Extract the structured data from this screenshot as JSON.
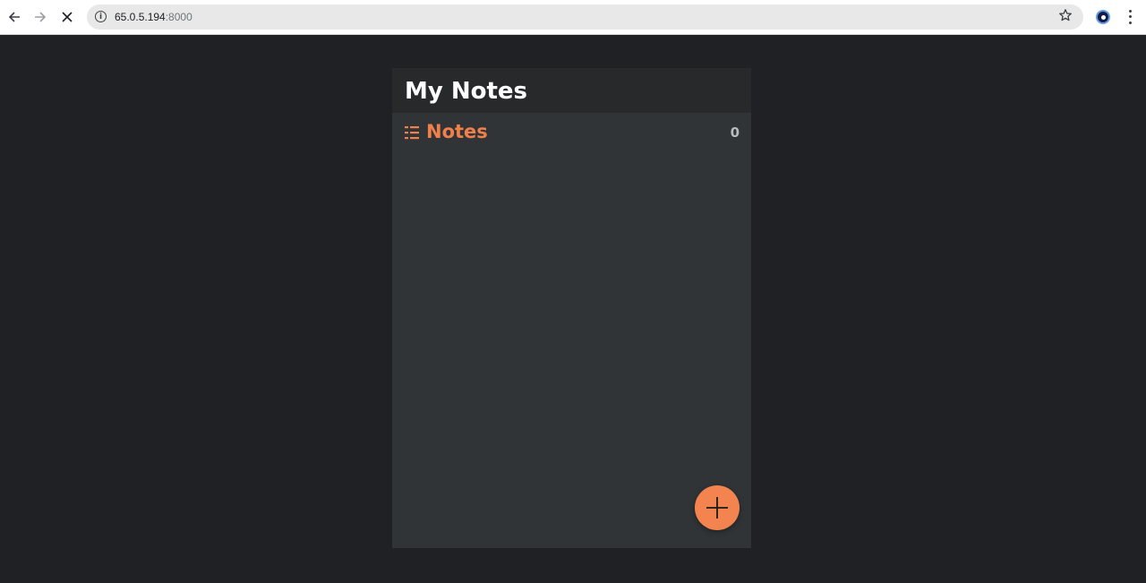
{
  "browser": {
    "url_host": "65.0.5.194",
    "url_port": ":8000",
    "back_icon": "arrow-left-icon",
    "forward_icon": "arrow-right-icon",
    "stop_icon": "close-icon",
    "info_icon": "info-icon",
    "bookmark_icon": "star-icon",
    "extension_icon": "extension-icon",
    "menu_icon": "kebab-menu-icon"
  },
  "app": {
    "title": "My Notes",
    "section": {
      "icon": "list-icon",
      "title": "Notes",
      "count": "0"
    },
    "fab_icon": "plus-icon"
  },
  "colors": {
    "page_background": "#202124",
    "panel_background": "#303437",
    "header_background": "#28292b",
    "accent": "#f4844f",
    "section_title": "#f0804a"
  }
}
